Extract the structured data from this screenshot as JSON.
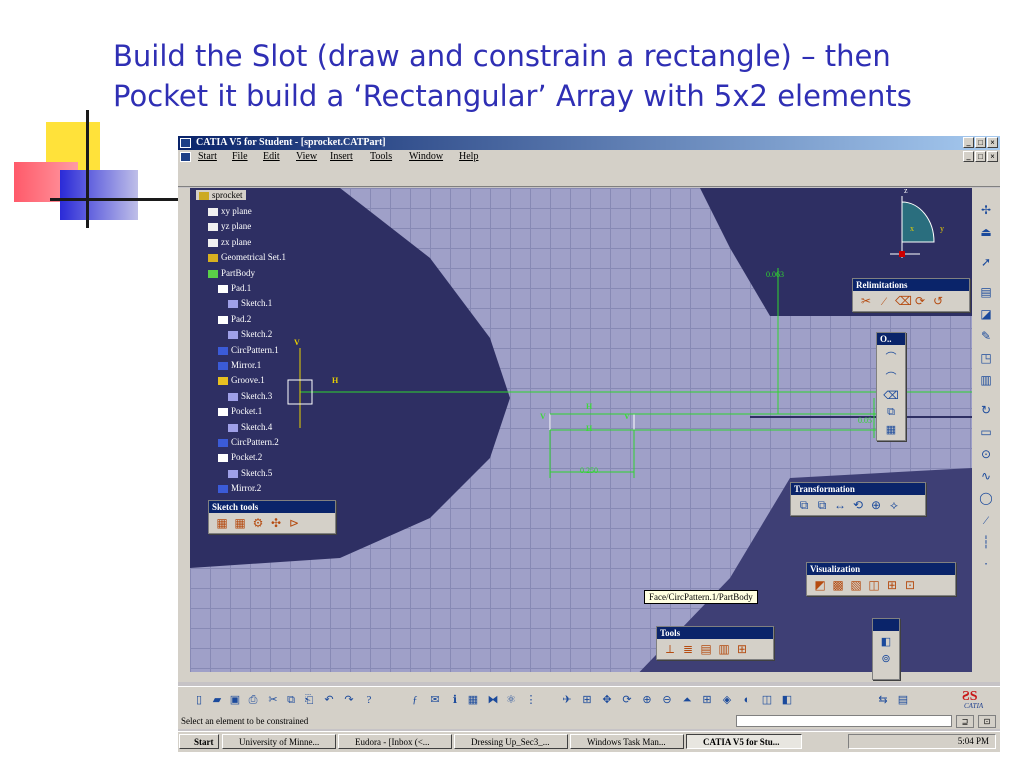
{
  "slide": {
    "title_line1": "Build the Slot (draw and constrain a rectangle) – then",
    "title_line2": "Pocket it build a  ‘Rectangular’ Array with 5x2 elements"
  },
  "window": {
    "title": "CATIA V5 for Student - [sprocket.CATPart]",
    "buttons": [
      "_",
      "□",
      "×"
    ]
  },
  "menu": [
    "Start",
    "File",
    "Edit",
    "View",
    "Insert",
    "Tools",
    "Window",
    "Help"
  ],
  "tree": {
    "root": "sprocket",
    "items": [
      "xy plane",
      "yz plane",
      "zx plane",
      "Geometrical Set.1",
      "PartBody",
      "Pad.1",
      "Sketch.1",
      "Pad.2",
      "Sketch.2",
      "CircPattern.1",
      "Mirror.1",
      "Groove.1",
      "Sketch.3",
      "Pocket.1",
      "Sketch.4",
      "CircPattern.2",
      "Pocket.2",
      "Sketch.5",
      "Mirror.2"
    ]
  },
  "panels": {
    "relimitations": "Relimitations",
    "operation": "O..",
    "transformation": "Transformation",
    "visualization": "Visualization",
    "sketch_tools": "Sketch tools",
    "tools": "Tools"
  },
  "canvas": {
    "axis_h": "H",
    "axis_v": "V",
    "compass_z": "z",
    "compass_y": "y",
    "compass_x": "x",
    "dim_top": "0.063",
    "dim_width": "0.250",
    "dim_height": "0.05",
    "constraint_h": "H",
    "constraint_v": "V",
    "tooltip": "Face/CircPattern.1/PartBody"
  },
  "statusbar": {
    "message": "Select an element to be constrained"
  },
  "taskbar": {
    "start": "Start",
    "tasks": [
      "University of Minne...",
      "Eudora - [Inbox (<...",
      "Dressing Up_Sec3_...",
      "Windows Task Man...",
      "CATIA V5 for Stu..."
    ],
    "clock": "5:04 PM"
  },
  "logo": {
    "text": "CATIA"
  },
  "colors": {
    "title": "#2f2fb4",
    "canvas": "#9fa0c8",
    "part": "#2e2f63",
    "constraint": "#2fd52f",
    "panel_title": "#0a246a"
  }
}
